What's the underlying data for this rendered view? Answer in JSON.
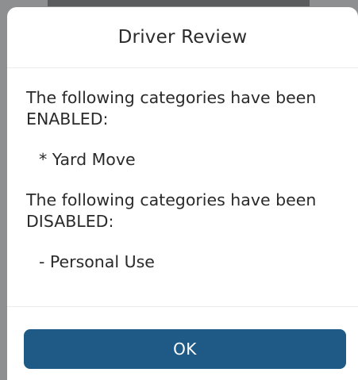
{
  "dialog": {
    "title": "Driver Review",
    "enabled_heading": "The following categories have been ENABLED:",
    "enabled_items": [
      "* Yard Move"
    ],
    "disabled_heading": "The following categories have been DISABLED:",
    "disabled_items": [
      "- Personal Use"
    ],
    "ok_label": "OK"
  },
  "colors": {
    "button": "#1e5a85",
    "backdrop": "#8e8f90",
    "text": "#2a2a2a"
  }
}
